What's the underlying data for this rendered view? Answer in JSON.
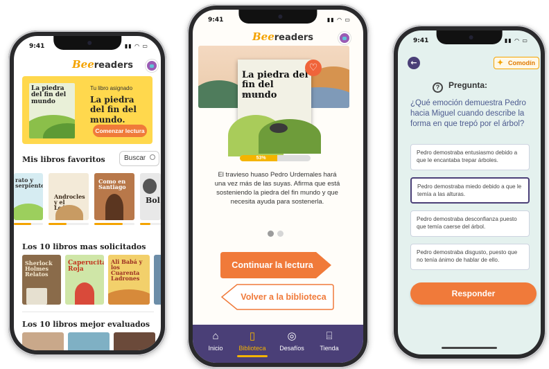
{
  "status": {
    "time": "9:41"
  },
  "brand": {
    "bee": "Bee",
    "readers": "readers"
  },
  "home": {
    "assigned_label": "Tu libro asignado",
    "assigned_title": "La piedra del fin del mundo.",
    "assigned_cover_title": "La piedra del fin del mundo",
    "start_button": "Comenzar lectura",
    "favorites_title": "Mis libros favoritos",
    "search_label": "Buscar",
    "favorites": [
      {
        "title": "rato y serpiente",
        "progress": 0.6
      },
      {
        "title": "Androcles y el León",
        "progress": 0.45
      },
      {
        "title": "Como en Santiago",
        "progress": 0.7
      },
      {
        "title": "Bol",
        "progress": 0.5
      }
    ],
    "most_requested_title": "Los 10 libros mas solicitados",
    "requested": [
      {
        "title": "Sherlock Holmes Relatos"
      },
      {
        "title": "Caperucita Roja"
      },
      {
        "title": "Ali Babá y los Cuarenta Ladrones"
      }
    ],
    "best_rated_title": "Los 10 libros mejor evaluados"
  },
  "library": {
    "cover_title": "La piedra del fin del mundo",
    "cover_author": "Ramón Laval",
    "progress_label": "53%",
    "progress": 0.53,
    "description": "El travieso huaso Pedro Urdemales hará una vez más de las suyas. Afirma que está sosteniendo la piedra del fin mundo y que necesita ayuda para sostenerla.",
    "continue_button": "Continuar la lectura",
    "back_button": "Volver a la biblioteca",
    "tabs": [
      {
        "label": "Inicio",
        "icon": "home-icon",
        "glyph": "⌂"
      },
      {
        "label": "Biblioteca",
        "icon": "book-icon",
        "glyph": "▯"
      },
      {
        "label": "Desafíos",
        "icon": "target-icon",
        "glyph": "◎"
      },
      {
        "label": "Tienda",
        "icon": "store-icon",
        "glyph": "⌸"
      }
    ]
  },
  "quiz": {
    "wildcard_label": "Comodín",
    "question_label": "Pregunta:",
    "question": "¿Qué emoción demuestra Pedro hacia Miguel cuando describe la forma en que trepó por el árbol?",
    "options": [
      "Pedro demostraba entusiasmo debido a que le encantaba trepar árboles.",
      "Pedro demostraba miedo debido a que le temía a las alturas.",
      "Pedro demostraba desconfianza puesto que temía caerse del árbol.",
      "Pedro demostraba disgusto, puesto que no tenía ánimo de hablar de ello."
    ],
    "selected_index": 1,
    "submit_button": "Responder"
  },
  "colors": {
    "accent_orange": "#f07a3a",
    "brand_yellow": "#f4b400",
    "purple": "#4a3f77"
  }
}
